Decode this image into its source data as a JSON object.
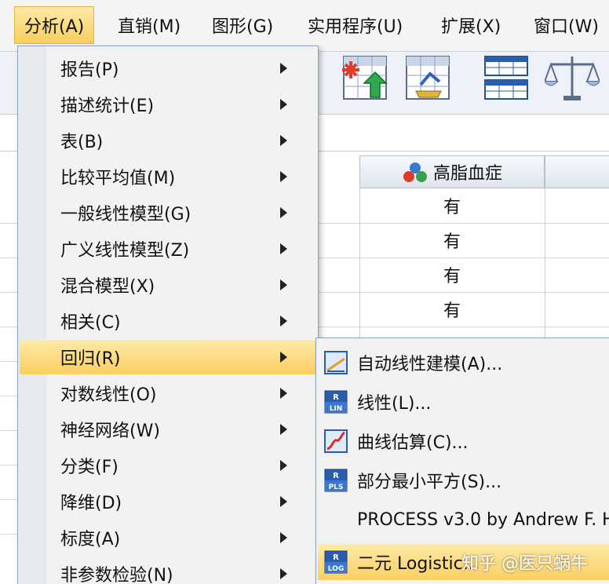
{
  "menubar": {
    "items": [
      {
        "label": "分析(A)",
        "active": true
      },
      {
        "label": "直销(M)"
      },
      {
        "label": "图形(G)"
      },
      {
        "label": "实用程序(U)"
      },
      {
        "label": "扩展(X)"
      },
      {
        "label": "窗口(W)"
      }
    ]
  },
  "toolbar": {
    "icons": [
      "select-cases-icon",
      "weight-cases-icon",
      "value-labels-icon",
      "use-sets-icon"
    ]
  },
  "grid": {
    "column_header": "高脂血症",
    "cells": [
      "有",
      "有",
      "有",
      "有"
    ]
  },
  "analyze_menu": {
    "items": [
      {
        "label": "报告(P)"
      },
      {
        "label": "描述统计(E)"
      },
      {
        "label": "表(B)"
      },
      {
        "label": "比较平均值(M)"
      },
      {
        "label": "一般线性模型(G)"
      },
      {
        "label": "广义线性模型(Z)"
      },
      {
        "label": "混合模型(X)"
      },
      {
        "label": "相关(C)"
      },
      {
        "label": "回归(R)",
        "active": true
      },
      {
        "label": "对数线性(O)"
      },
      {
        "label": "神经网络(W)"
      },
      {
        "label": "分类(F)"
      },
      {
        "label": "降维(D)"
      },
      {
        "label": "标度(A)"
      },
      {
        "label": "非参数检验(N)"
      }
    ]
  },
  "regression_submenu": {
    "items": [
      {
        "label": "自动线性建模(A)...",
        "icon": "auto-linear-icon"
      },
      {
        "label": "线性(L)...",
        "icon": "linear-regression-icon",
        "badge": "LIN"
      },
      {
        "label": "曲线估算(C)...",
        "icon": "curve-estimation-icon"
      },
      {
        "label": "部分最小平方(S)...",
        "icon": "partial-least-squares-icon",
        "badge": "PLS"
      },
      {
        "label": "PROCESS v3.0 by Andrew F. H",
        "icon": ""
      },
      {
        "label": "二元 Logistic...",
        "icon": "binary-logistic-icon",
        "badge": "LOG",
        "active": true
      }
    ]
  },
  "watermark": "知乎 @医只蜗牛",
  "colors": {
    "highlight": "#f9cf60",
    "menu_bg": "#f2f2f2",
    "menu_border": "#8fa3c0"
  }
}
